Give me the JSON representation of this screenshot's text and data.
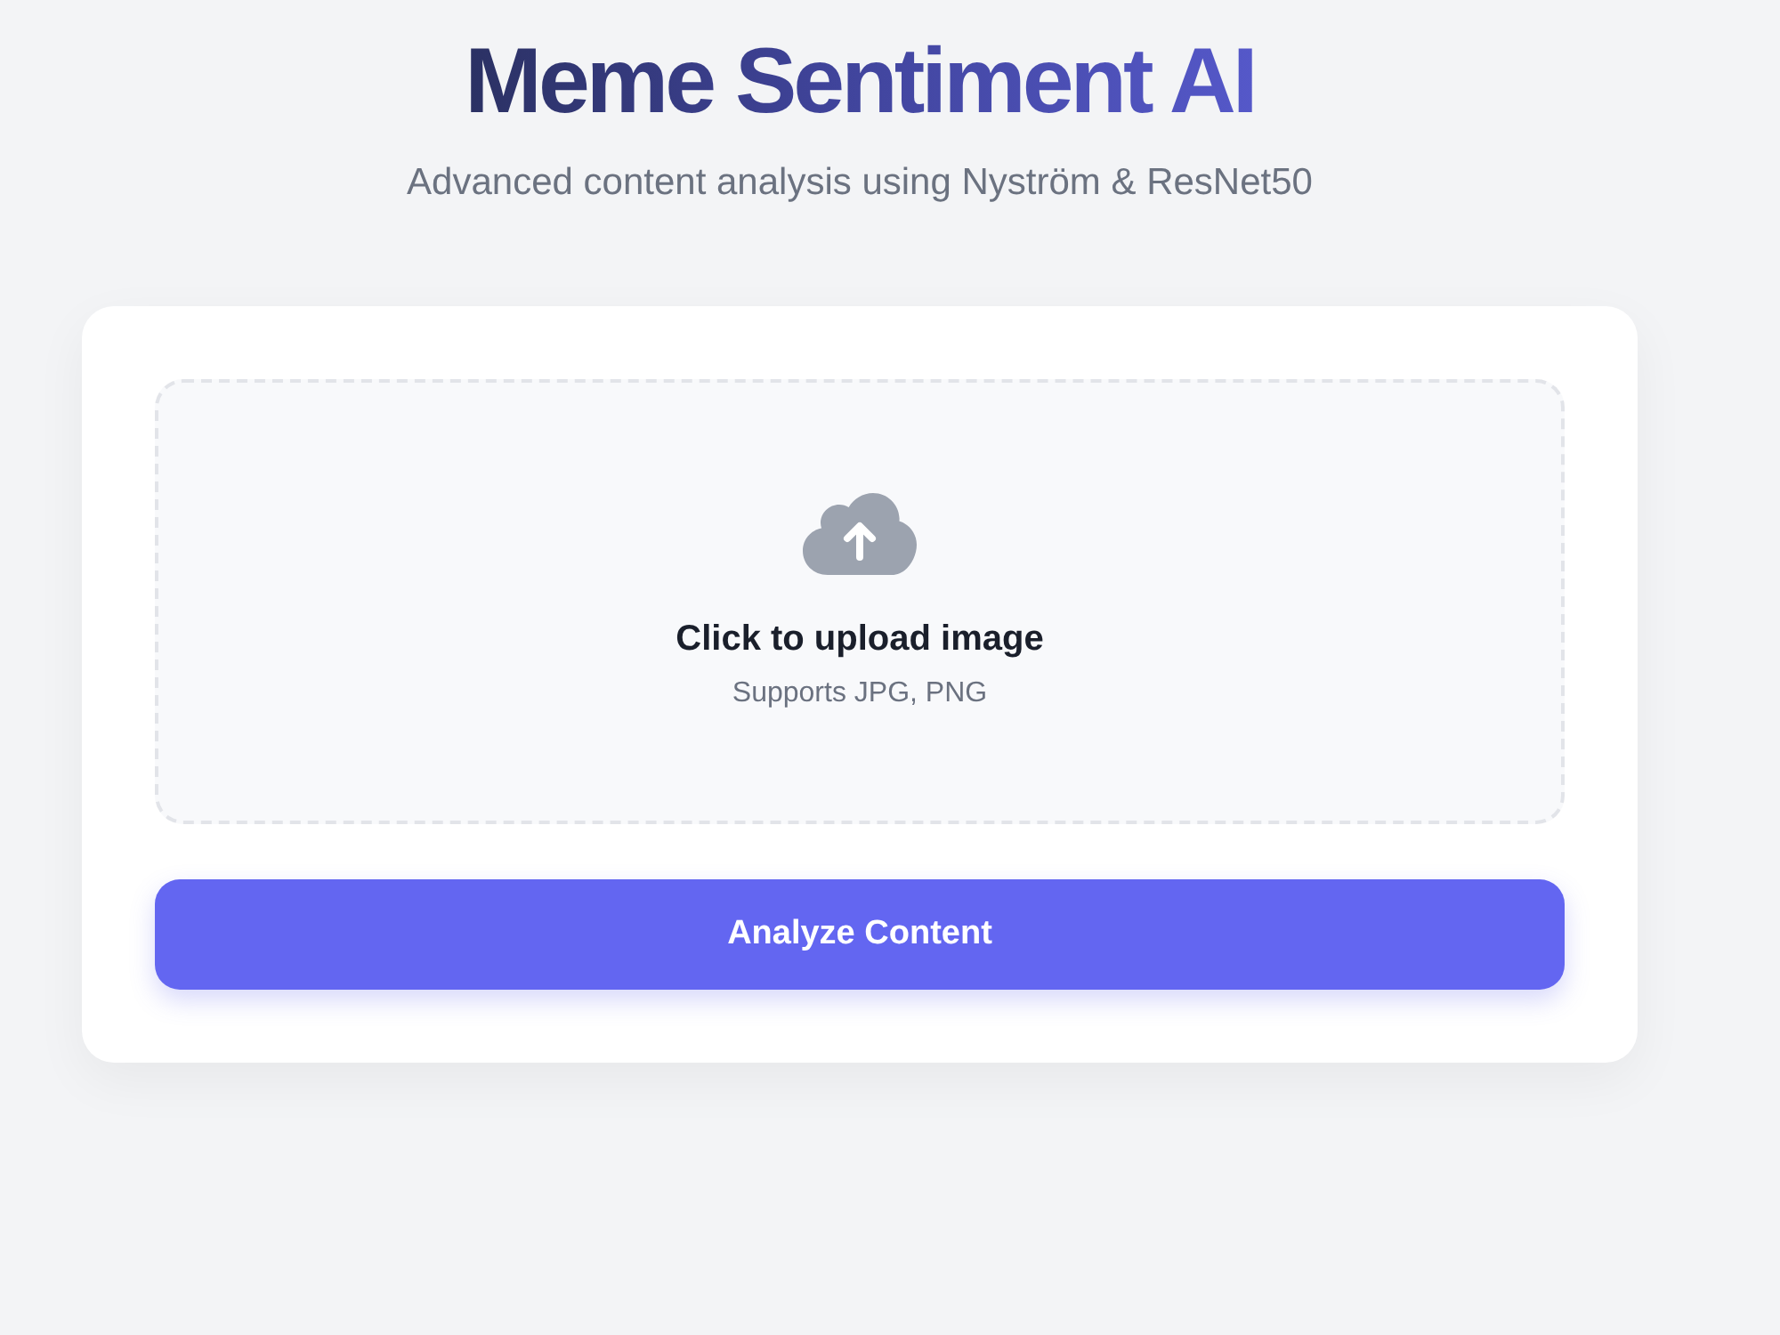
{
  "header": {
    "title": "Meme Sentiment AI",
    "subtitle": "Advanced content analysis using Nyström & ResNet50"
  },
  "upload": {
    "title": "Click to upload image",
    "hint": "Supports JPG, PNG"
  },
  "button": {
    "label": "Analyze Content"
  }
}
